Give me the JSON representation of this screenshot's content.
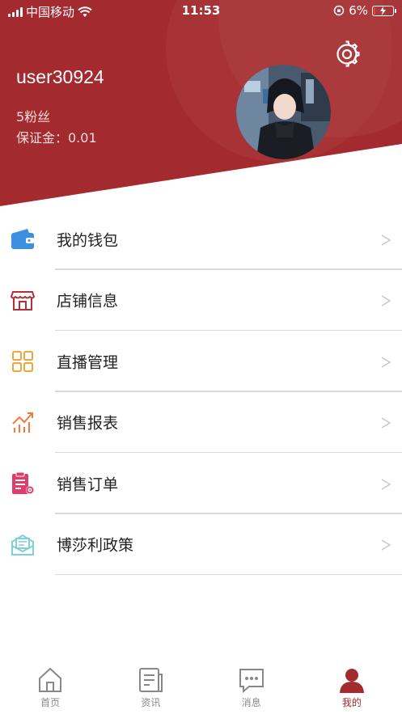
{
  "status_bar": {
    "carrier": "中国移动",
    "time": "11:53",
    "battery_percent": "6%"
  },
  "profile": {
    "username": "user30924",
    "fans": "5粉丝",
    "deposit": "保证金：0.01"
  },
  "colors": {
    "brand_red": "#a32b2f",
    "wallet_blue": "#3d8fe0",
    "store_red": "#b0313a",
    "live_orange": "#f0a53a",
    "report_orange": "#f07a3a",
    "order_pink": "#e23c6b",
    "policy_teal": "#7fd0d8"
  },
  "menu": {
    "items": [
      {
        "label": "我的钱包",
        "icon": "wallet-icon"
      },
      {
        "label": "店铺信息",
        "icon": "store-icon"
      },
      {
        "label": "直播管理",
        "icon": "grid-icon"
      },
      {
        "label": "销售报表",
        "icon": "chart-icon"
      },
      {
        "label": "销售订单",
        "icon": "order-icon"
      },
      {
        "label": "博莎利政策",
        "icon": "mail-icon"
      }
    ],
    "chevron": ">"
  },
  "tabbar": {
    "tabs": [
      {
        "label": "首页",
        "icon": "home-icon"
      },
      {
        "label": "资讯",
        "icon": "news-icon"
      },
      {
        "label": "消息",
        "icon": "message-icon"
      },
      {
        "label": "我的",
        "icon": "person-icon"
      }
    ],
    "active": "我的"
  }
}
